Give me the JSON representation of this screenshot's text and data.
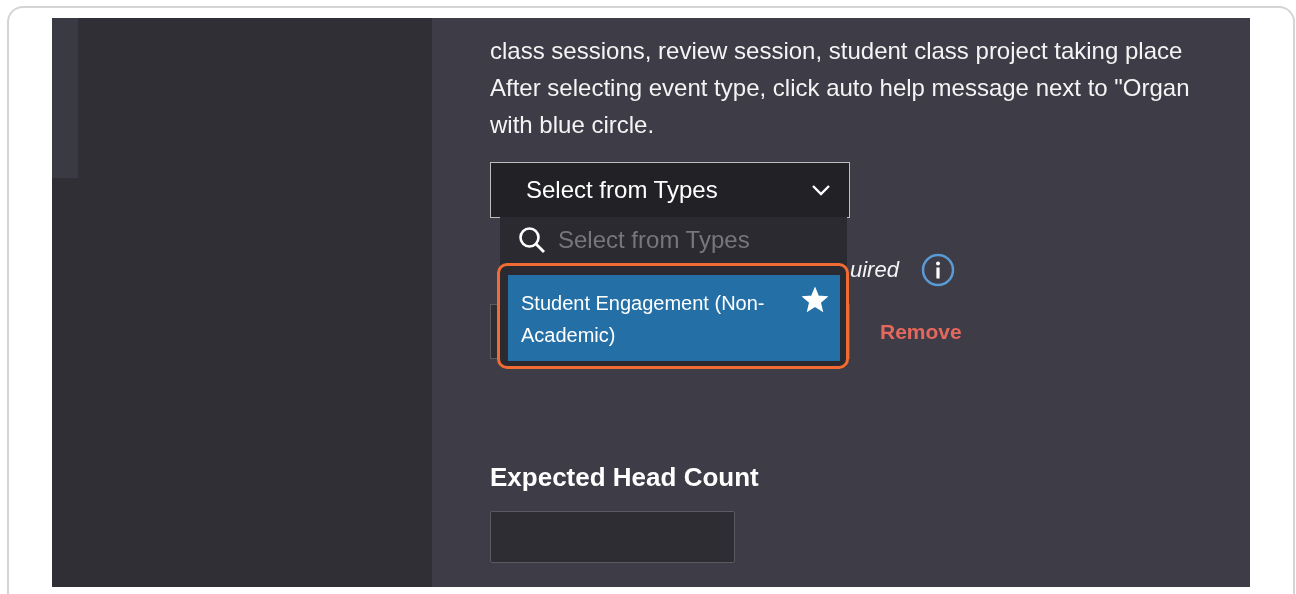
{
  "help_text_lines": [
    "class sessions, review session, student class project taking place",
    "After selecting event type, click auto help message next to \"Organ",
    "with blue circle."
  ],
  "type_select": {
    "value": "Select from Types",
    "expanded": true,
    "search_placeholder": "Select from Types",
    "options": [
      {
        "label": "Student Engagement (Non-Academic)",
        "selected": true,
        "favorite": true,
        "highlighted": true
      }
    ]
  },
  "covered_field": {
    "required_fragment": "uired",
    "remove_label": "Remove"
  },
  "head_count": {
    "label": "Expected Head Count"
  }
}
